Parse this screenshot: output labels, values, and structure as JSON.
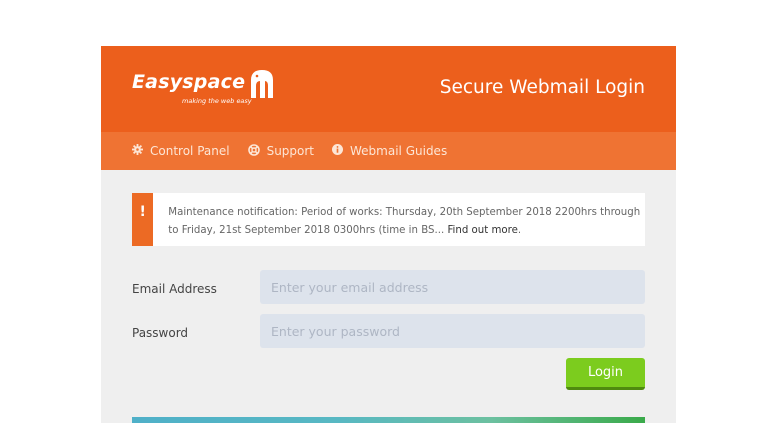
{
  "brand": {
    "name": "Easyspace",
    "tagline": "making the web easy"
  },
  "header": {
    "title": "Secure Webmail Login"
  },
  "nav": {
    "items": [
      {
        "label": "Control Panel",
        "icon": "gear-icon"
      },
      {
        "label": "Support",
        "icon": "lifebuoy-icon"
      },
      {
        "label": "Webmail Guides",
        "icon": "info-icon"
      }
    ]
  },
  "notice": {
    "icon": "!",
    "text": "Maintenance notification:  Period of works: Thursday, 20th September 2018 2200hrs through to Friday, 21st September 2018 0300hrs (time in BS... ",
    "link_text": "Find out more",
    "suffix": "."
  },
  "form": {
    "email_label": "Email Address",
    "email_placeholder": "Enter your email address",
    "password_label": "Password",
    "password_placeholder": "Enter your password",
    "login_label": "Login"
  },
  "colors": {
    "header": "#ec5f1c",
    "nav": "#ef7333",
    "login": "#7ccc1e"
  }
}
